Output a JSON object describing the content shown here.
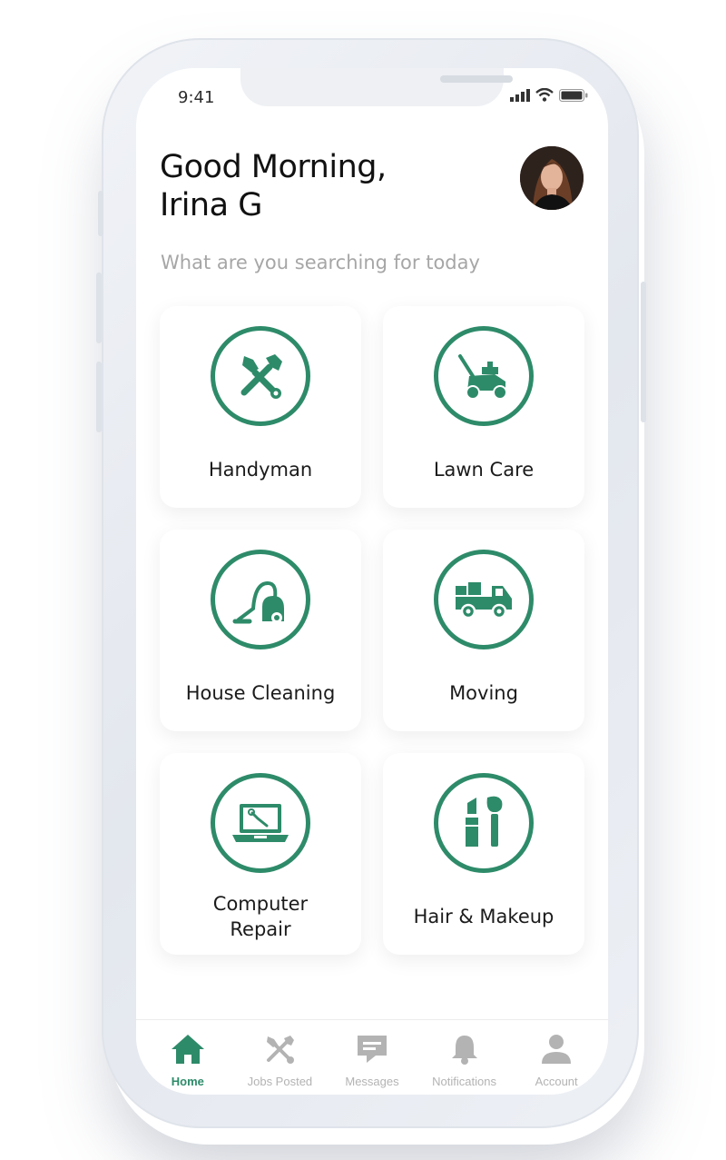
{
  "status_bar": {
    "time": "9:41"
  },
  "header": {
    "greeting_line1": "Good Morning,",
    "greeting_line2": "Irina G",
    "subtitle": "What are you searching for today"
  },
  "services": [
    {
      "label": "Handyman",
      "icon": "tools-icon"
    },
    {
      "label": "Lawn Care",
      "icon": "lawn-mower-icon"
    },
    {
      "label": "House Cleaning",
      "icon": "vacuum-icon"
    },
    {
      "label": "Moving",
      "icon": "truck-icon"
    },
    {
      "label_line1": "Computer",
      "label_line2": "Repair",
      "icon": "laptop-repair-icon"
    },
    {
      "label": "Hair & Makeup",
      "icon": "makeup-icon"
    }
  ],
  "tabbar": {
    "items": [
      {
        "label": "Home",
        "icon": "home-icon",
        "active": true
      },
      {
        "label": "Jobs Posted",
        "icon": "tools-icon",
        "active": false
      },
      {
        "label": "Messages",
        "icon": "message-icon",
        "active": false
      },
      {
        "label": "Notifications",
        "icon": "bell-icon",
        "active": false
      },
      {
        "label": "Account",
        "icon": "user-icon",
        "active": false
      }
    ]
  },
  "colors": {
    "accent": "#2e8b6a",
    "inactive": "#b3b3b3"
  }
}
